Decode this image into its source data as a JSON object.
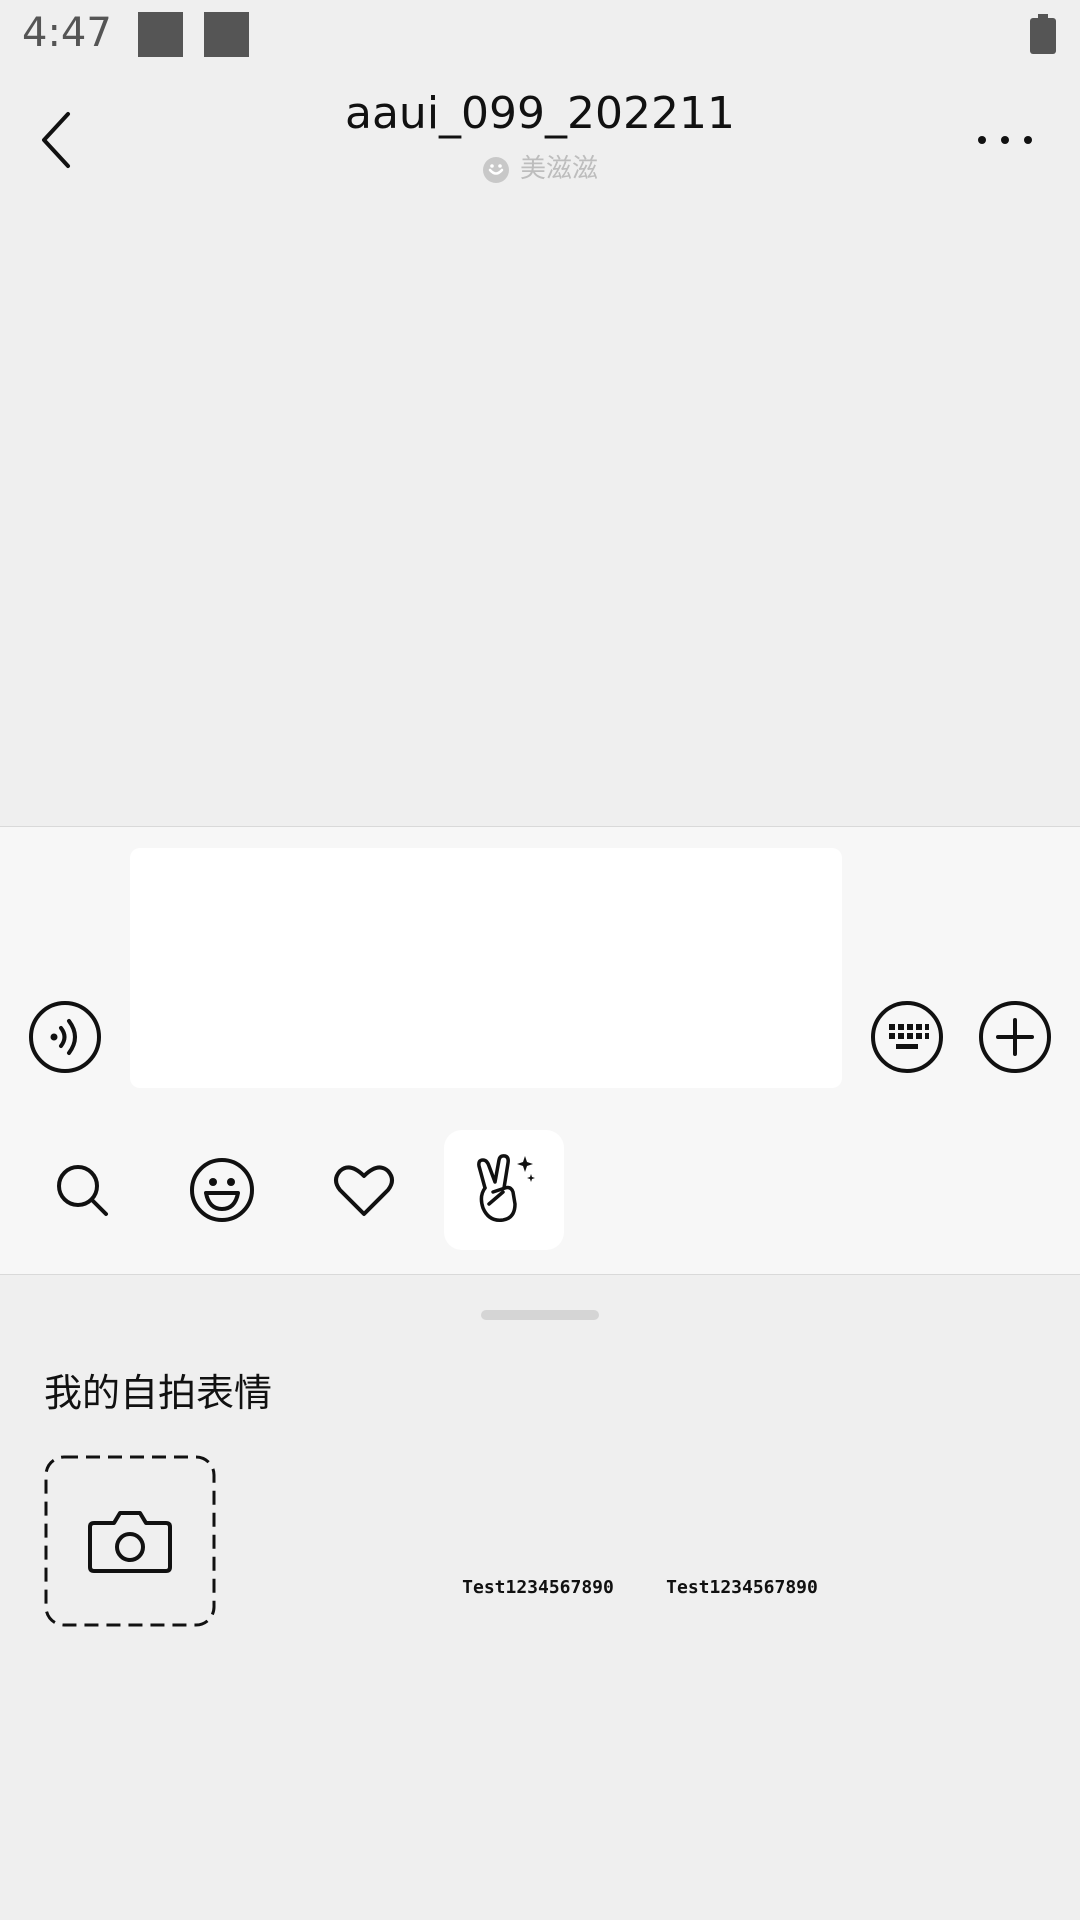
{
  "status_bar": {
    "time": "4:47",
    "battery_icon": "battery-icon"
  },
  "header": {
    "title": "aaui_099_202211",
    "subtitle": "美滋滋",
    "back_icon": "back-chevron-icon",
    "more_icon": "more-dots-icon",
    "subtitle_icon": "smiley-badge-icon"
  },
  "composer": {
    "input_value": "",
    "voice_icon": "voice-icon",
    "keyboard_icon": "keyboard-icon",
    "plus_icon": "plus-icon"
  },
  "tabs": [
    {
      "icon": "search-icon"
    },
    {
      "icon": "emoji-icon"
    },
    {
      "icon": "heart-icon"
    },
    {
      "icon": "selfie-sticker-icon",
      "selected": true
    }
  ],
  "sticker_panel": {
    "section_title": "我的自拍表情",
    "add_icon": "camera-icon",
    "stickers": [
      {
        "label": "Test1234567890"
      },
      {
        "label": "Test1234567890"
      }
    ]
  }
}
